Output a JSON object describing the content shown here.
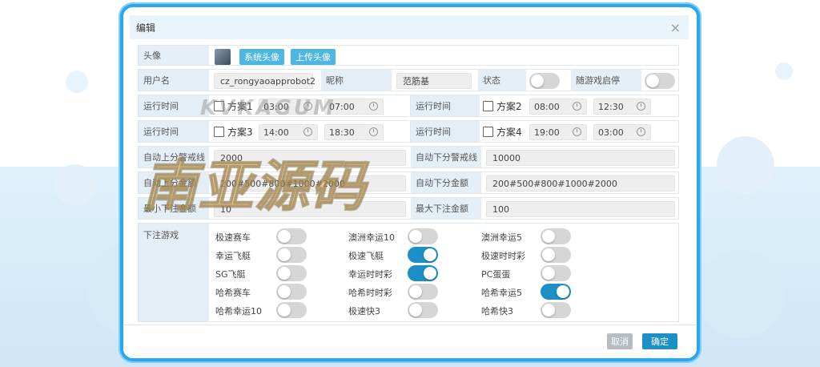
{
  "dialog": {
    "title": "编辑"
  },
  "avatar": {
    "label": "头像",
    "system_btn": "系统头像",
    "upload_btn": "上传头像"
  },
  "user": {
    "username_label": "用户名",
    "username_value": "cz_rongyaoapprobot2",
    "nickname_label": "昵称",
    "nickname_value": "范筋基",
    "status_label": "状态",
    "status_on": false,
    "follow_label": "随游戏启停",
    "follow_on": false
  },
  "schedule": [
    {
      "label": "运行时间",
      "plan_a": {
        "name": "方案1",
        "start": "03:00",
        "end": "07:00"
      },
      "plan_b": {
        "label": "运行时间",
        "name": "方案2",
        "start": "08:00",
        "end": "12:30"
      }
    },
    {
      "label": "运行时间",
      "plan_a": {
        "name": "方案3",
        "start": "14:00",
        "end": "18:30"
      },
      "plan_b": {
        "label": "运行时间",
        "name": "方案4",
        "start": "19:00",
        "end": "03:00"
      }
    }
  ],
  "limits": {
    "auto_up_warn_label": "自动上分警戒线",
    "auto_up_warn_value": "2000",
    "auto_down_warn_label": "自动下分警戒线",
    "auto_down_warn_value": "10000",
    "auto_up_amount_label": "自动上分金额",
    "auto_up_amount_value": "200#500#800#1000#2000",
    "auto_down_amount_label": "自动下分金额",
    "auto_down_amount_value": "200#500#800#1000#2000",
    "min_bet_label": "最小下注金额",
    "min_bet_value": "10",
    "max_bet_label": "最大下注金额",
    "max_bet_value": "100"
  },
  "games": {
    "label": "下注游戏",
    "items": [
      {
        "name": "极速赛车",
        "on": false
      },
      {
        "name": "澳洲幸运10",
        "on": false
      },
      {
        "name": "澳洲幸运5",
        "on": false
      },
      {
        "name": "幸运飞艇",
        "on": false
      },
      {
        "name": "极速飞艇",
        "on": true
      },
      {
        "name": "极速时时彩",
        "on": false
      },
      {
        "name": "SG飞艇",
        "on": false
      },
      {
        "name": "幸运时时彩",
        "on": true
      },
      {
        "name": "PC蛋蛋",
        "on": false
      },
      {
        "name": "哈希赛车",
        "on": false
      },
      {
        "name": "哈希时时彩",
        "on": false
      },
      {
        "name": "哈希幸运5",
        "on": true
      },
      {
        "name": "哈希幸运10",
        "on": false
      },
      {
        "name": "极速快3",
        "on": false
      },
      {
        "name": "哈希快3",
        "on": false
      }
    ]
  },
  "footer": {
    "cancel": "取消",
    "ok": "确定"
  },
  "watermark": {
    "top_text": "KVKAGUM",
    "main_text": "南亚源码"
  },
  "colors": {
    "frame": "#2ba7ee",
    "primary": "#1c8fc6",
    "label_bg": "#e4eef6"
  }
}
